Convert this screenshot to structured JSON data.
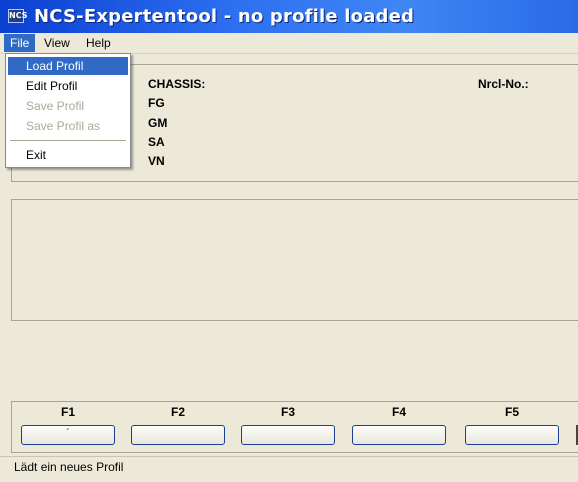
{
  "window": {
    "title": "NCS-Expertentool - no profile loaded",
    "icon": "app-icon",
    "icon_text": "NCS"
  },
  "menubar": {
    "items": [
      {
        "label": "File",
        "active": true
      },
      {
        "label": "View",
        "active": false
      },
      {
        "label": "Help",
        "active": false
      }
    ]
  },
  "file_menu": {
    "items": [
      {
        "label": "Load Profil",
        "state": "selected"
      },
      {
        "label": "Edit Profil",
        "state": "enabled"
      },
      {
        "label": "Save Profil",
        "state": "disabled"
      },
      {
        "label": "Save Profil as",
        "state": "disabled"
      },
      {
        "label": "Exit",
        "state": "enabled"
      }
    ]
  },
  "info": {
    "chassis_label": "CHASSIS:",
    "fg_label": "FG",
    "gm_label": "GM",
    "sa_label": "SA",
    "vn_label": "VN",
    "nrcl_label": "Nrcl-No.:"
  },
  "function_keys": [
    {
      "label": "F1",
      "button_text": "´"
    },
    {
      "label": "F2",
      "button_text": ""
    },
    {
      "label": "F3",
      "button_text": ""
    },
    {
      "label": "F4",
      "button_text": ""
    },
    {
      "label": "F5",
      "button_text": ""
    }
  ],
  "statusbar": {
    "text": "Lädt ein neues Profil"
  },
  "colors": {
    "title_bar": "#2d6ff0",
    "menu_highlight": "#316ac5",
    "window_bg": "#ece9d8",
    "disabled_text": "#aca899"
  }
}
